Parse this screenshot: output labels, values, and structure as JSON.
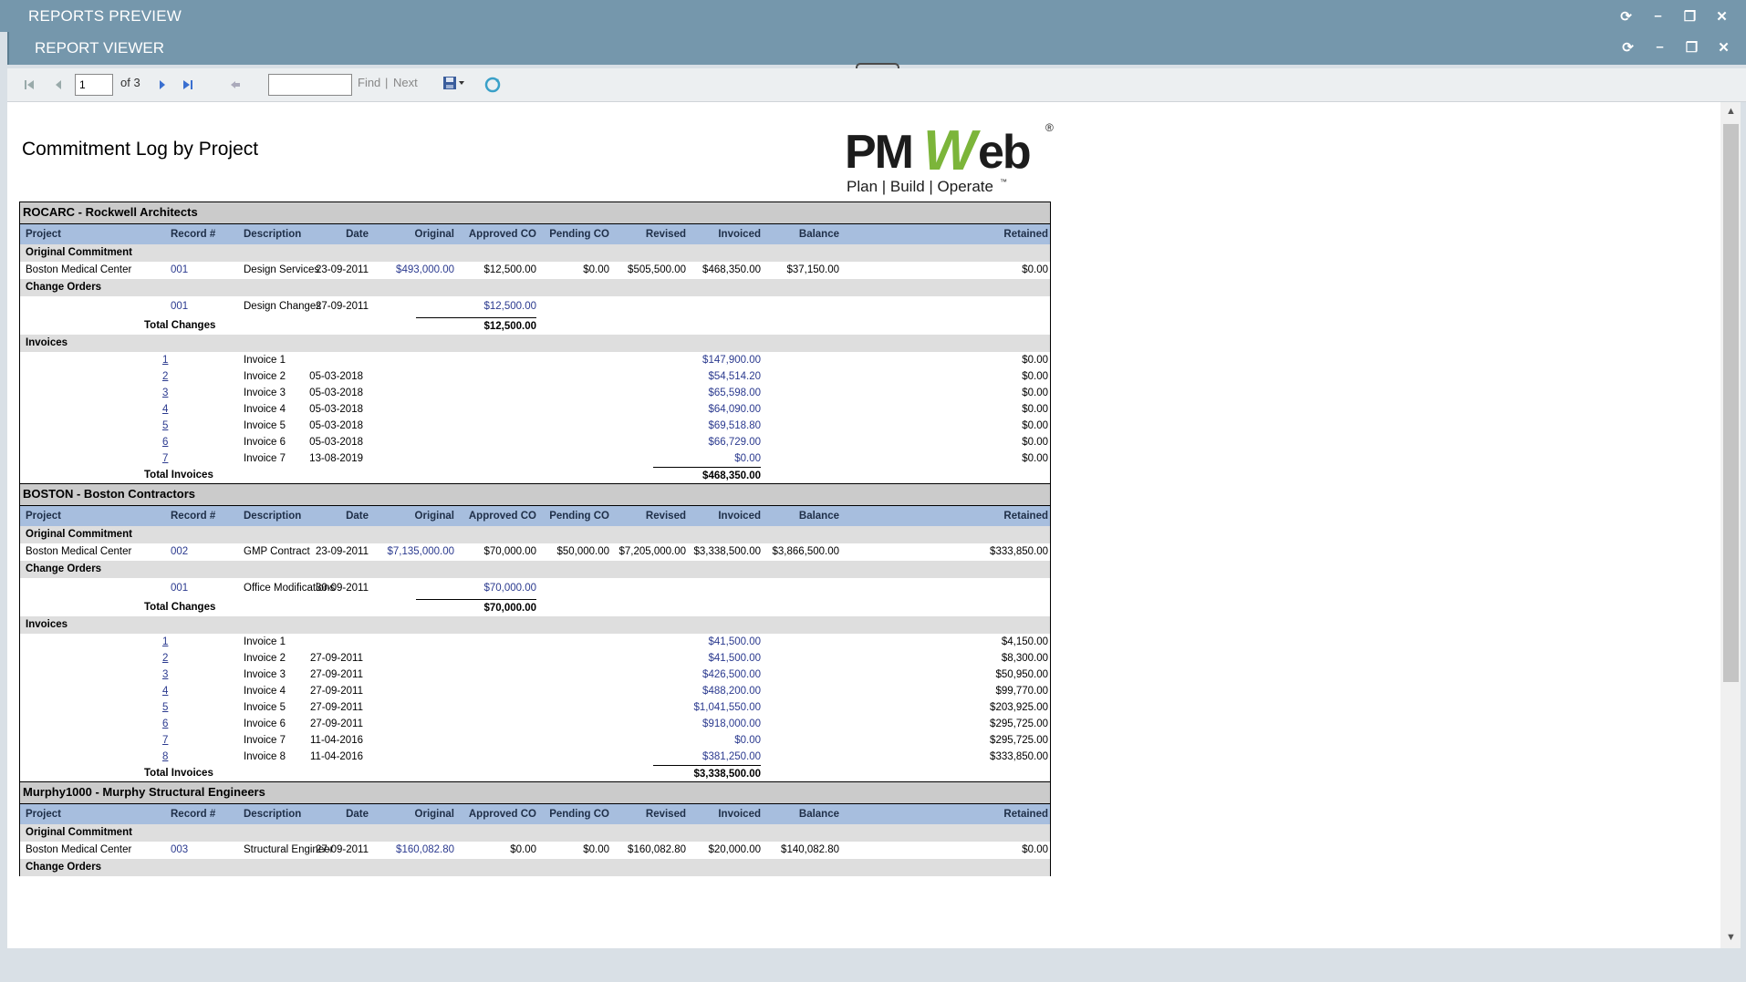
{
  "window": {
    "title": "REPORTS PREVIEW",
    "viewer_title": "REPORT VIEWER"
  },
  "toolbar": {
    "page_value": "1",
    "of_pages": "of 3",
    "find": "Find",
    "sep": "|",
    "next": "Next"
  },
  "report": {
    "title": "Commitment Log by Project",
    "logo_main": "PMWeb",
    "logo_reg": "®",
    "logo_tag": "Plan | Build | Operate",
    "logo_tm": "™",
    "columns": [
      "Project",
      "Record #",
      "Description",
      "Date",
      "Original",
      "Approved CO",
      "Pending CO",
      "Revised",
      "Invoiced",
      "Balance",
      "Retained"
    ],
    "labels": {
      "original_commitment": "Original Commitment",
      "change_orders": "Change Orders",
      "total_changes": "Total Changes",
      "invoices": "Invoices",
      "total_invoices": "Total Invoices"
    },
    "groups": [
      {
        "title": "ROCARC - Rockwell Architects",
        "commitment": {
          "project": "Boston Medical Center",
          "record": "001",
          "description": "Design Services",
          "date": "23-09-2011",
          "original": "$493,000.00",
          "approved_co": "$12,500.00",
          "pending_co": "$0.00",
          "revised": "$505,500.00",
          "invoiced": "$468,350.00",
          "balance": "$37,150.00",
          "retained": "$0.00"
        },
        "change_orders": [
          {
            "record": "001",
            "description": "Design Changes",
            "date": "27-09-2011",
            "amount": "$12,500.00"
          }
        ],
        "total_changes": "$12,500.00",
        "invoices": [
          {
            "record": "1",
            "description": "Invoice 1",
            "date": "",
            "invoiced": "$147,900.00",
            "retained": "$0.00"
          },
          {
            "record": "2",
            "description": "Invoice 2",
            "date": "05-03-2018",
            "invoiced": "$54,514.20",
            "retained": "$0.00"
          },
          {
            "record": "3",
            "description": "Invoice 3",
            "date": "05-03-2018",
            "invoiced": "$65,598.00",
            "retained": "$0.00"
          },
          {
            "record": "4",
            "description": "Invoice 4",
            "date": "05-03-2018",
            "invoiced": "$64,090.00",
            "retained": "$0.00"
          },
          {
            "record": "5",
            "description": "Invoice 5",
            "date": "05-03-2018",
            "invoiced": "$69,518.80",
            "retained": "$0.00"
          },
          {
            "record": "6",
            "description": "Invoice 6",
            "date": "05-03-2018",
            "invoiced": "$66,729.00",
            "retained": "$0.00"
          },
          {
            "record": "7",
            "description": "Invoice 7",
            "date": "13-08-2019",
            "invoiced": "$0.00",
            "retained": "$0.00"
          }
        ],
        "total_invoices": "$468,350.00"
      },
      {
        "title": "BOSTON - Boston Contractors",
        "commitment": {
          "project": "Boston Medical Center",
          "record": "002",
          "description": "GMP Contract",
          "date": "23-09-2011",
          "original": "$7,135,000.00",
          "approved_co": "$70,000.00",
          "pending_co": "$50,000.00",
          "revised": "$7,205,000.00",
          "invoiced": "$3,338,500.00",
          "balance": "$3,866,500.00",
          "retained": "$333,850.00"
        },
        "change_orders": [
          {
            "record": "001",
            "description": "Office Modifications",
            "date": "30-09-2011",
            "amount": "$70,000.00"
          }
        ],
        "total_changes": "$70,000.00",
        "invoices": [
          {
            "record": "1",
            "description": "Invoice 1",
            "date": "",
            "invoiced": "$41,500.00",
            "retained": "$4,150.00"
          },
          {
            "record": "2",
            "description": "Invoice 2",
            "date": "27-09-2011",
            "invoiced": "$41,500.00",
            "retained": "$8,300.00"
          },
          {
            "record": "3",
            "description": "Invoice 3",
            "date": "27-09-2011",
            "invoiced": "$426,500.00",
            "retained": "$50,950.00"
          },
          {
            "record": "4",
            "description": "Invoice 4",
            "date": "27-09-2011",
            "invoiced": "$488,200.00",
            "retained": "$99,770.00"
          },
          {
            "record": "5",
            "description": "Invoice 5",
            "date": "27-09-2011",
            "invoiced": "$1,041,550.00",
            "retained": "$203,925.00"
          },
          {
            "record": "6",
            "description": "Invoice 6",
            "date": "27-09-2011",
            "invoiced": "$918,000.00",
            "retained": "$295,725.00"
          },
          {
            "record": "7",
            "description": "Invoice 7",
            "date": "11-04-2016",
            "invoiced": "$0.00",
            "retained": "$295,725.00"
          },
          {
            "record": "8",
            "description": "Invoice 8",
            "date": "11-04-2016",
            "invoiced": "$381,250.00",
            "retained": "$333,850.00"
          }
        ],
        "total_invoices": "$3,338,500.00"
      },
      {
        "title": "Murphy1000 - Murphy Structural Engineers",
        "commitment": {
          "project": "Boston Medical Center",
          "record": "003",
          "description": "Structural Engineer",
          "date": "27-09-2011",
          "original": "$160,082.80",
          "approved_co": "$0.00",
          "pending_co": "$0.00",
          "revised": "$160,082.80",
          "invoiced": "$20,000.00",
          "balance": "$140,082.80",
          "retained": "$0.00"
        },
        "change_orders": [],
        "total_changes": "",
        "invoices": [],
        "total_invoices": ""
      }
    ]
  }
}
